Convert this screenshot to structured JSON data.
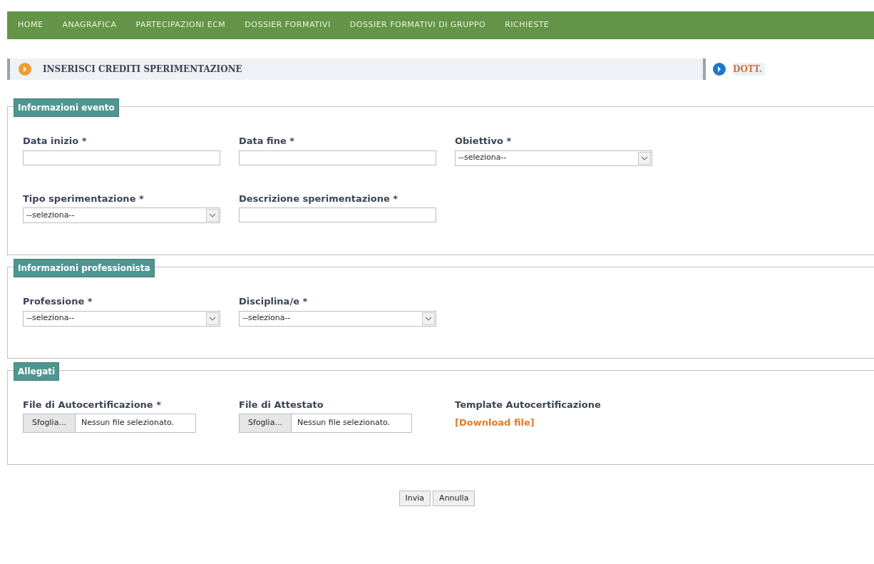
{
  "nav": {
    "items": [
      {
        "label": "HOME"
      },
      {
        "label": "ANAGRAFICA"
      },
      {
        "label": "PARTECIPAZIONI ECM"
      },
      {
        "label": "DOSSIER FORMATIVI"
      },
      {
        "label": "DOSSIER FORMATIVI DI GRUPPO"
      },
      {
        "label": "RICHIESTE"
      }
    ]
  },
  "header": {
    "title": "INSERISCI CREDITI SPERIMENTAZIONE",
    "user": "DOTT."
  },
  "sections": [
    {
      "legend": "Informazioni evento",
      "rows": [
        [
          {
            "kind": "text",
            "label": "Data inizio *"
          },
          {
            "kind": "text",
            "label": "Data fine *"
          },
          {
            "kind": "select",
            "label": "Obiettivo *",
            "value": "--seleziona--"
          }
        ],
        [
          {
            "kind": "select",
            "label": "Tipo sperimentazione *",
            "value": "--seleziona--"
          },
          {
            "kind": "text",
            "label": "Descrizione sperimentazione *"
          }
        ]
      ]
    },
    {
      "legend": "Informazioni professionista",
      "rows": [
        [
          {
            "kind": "select",
            "label": "Professione *",
            "value": "--seleziona--"
          },
          {
            "kind": "select",
            "label": "Disciplina/e *",
            "value": "--seleziona--"
          }
        ]
      ]
    },
    {
      "legend": "Allegati",
      "rows": [
        [
          {
            "kind": "file",
            "label": "File di Autocertificazione *",
            "button": "Sfoglia...",
            "value": "Nessun file selezionato."
          },
          {
            "kind": "file",
            "label": "File di Attestato",
            "button": "Sfoglia...",
            "value": "Nessun file selezionato."
          },
          {
            "kind": "link",
            "label": "Template Autocertificazione",
            "value": "[Download file]"
          }
        ]
      ]
    }
  ],
  "buttons": [
    {
      "label": "Invia"
    },
    {
      "label": "Annulla"
    }
  ]
}
